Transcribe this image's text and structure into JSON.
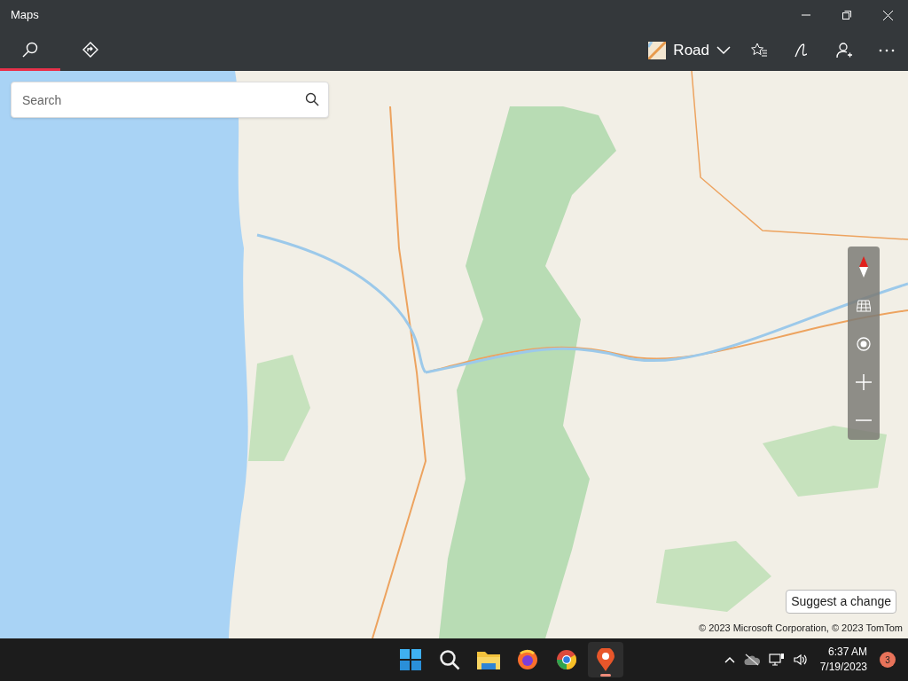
{
  "window": {
    "title": "Maps"
  },
  "tabs": [
    {
      "kind": "search",
      "selected": true
    },
    {
      "kind": "directions",
      "selected": false
    }
  ],
  "map_style": {
    "label": "Road"
  },
  "search": {
    "placeholder": "Search"
  },
  "map": {
    "suggest_button": "Suggest a change",
    "copyright": "© 2023 Microsoft Corporation, © 2023 TomTom"
  },
  "taskbar": {
    "apps": [
      {
        "kind": "start",
        "selected": false
      },
      {
        "kind": "search",
        "selected": false
      },
      {
        "kind": "files",
        "selected": false
      },
      {
        "kind": "firefox",
        "selected": false
      },
      {
        "kind": "chrome",
        "selected": false
      },
      {
        "kind": "maps",
        "selected": true
      }
    ],
    "time": "6:37 AM",
    "date": "7/19/2023",
    "notifications": "3"
  }
}
